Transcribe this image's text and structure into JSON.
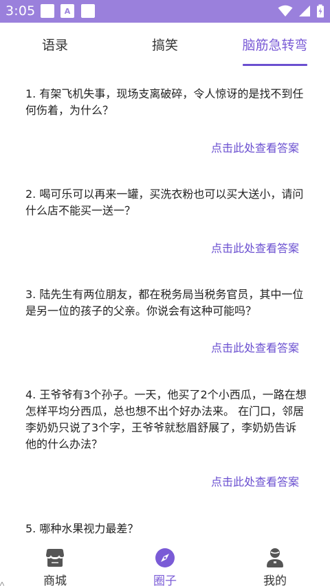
{
  "status": {
    "time": "3:05",
    "notif_letter": "A"
  },
  "tabs": [
    {
      "label": "语录"
    },
    {
      "label": "搞笑"
    },
    {
      "label": "脑筋急转弯"
    }
  ],
  "questions": [
    {
      "text": "1. 有架飞机失事，现场支离破碎，令人惊讶的是找不到任何伤着，为什么？",
      "answer_link": "点击此处查看答案"
    },
    {
      "text": "2. 喝可乐可以再来一罐，买洗衣粉也可以买大送小，请问什么店不能买一送一？",
      "answer_link": "点击此处查看答案"
    },
    {
      "text": "3. 陆先生有两位朋友，都在税务局当税务官员，其中一位是另一位的孩子的父亲。你说会有这种可能吗？",
      "answer_link": "点击此处查看答案"
    },
    {
      "text": "4. 王爷爷有3个孙子。一天，他买了2个小西瓜，一路在想怎样平均分西瓜，总也想不出个好办法来。 在门口，邻居李奶奶只说了3个字，王爷爷就愁眉舒展了，李奶奶告诉他的什么办法？",
      "answer_link": "点击此处查看答案"
    },
    {
      "text": "5. 哪种水果视力最差？"
    }
  ],
  "bottom_nav": [
    {
      "label": "商城",
      "icon": "store-icon"
    },
    {
      "label": "圈子",
      "icon": "compass-icon"
    },
    {
      "label": "我的",
      "icon": "user-icon"
    }
  ],
  "colors": {
    "status_bar": "#9a80dc",
    "accent": "#6a4fd0",
    "active_tab": "#7a5bd6"
  }
}
